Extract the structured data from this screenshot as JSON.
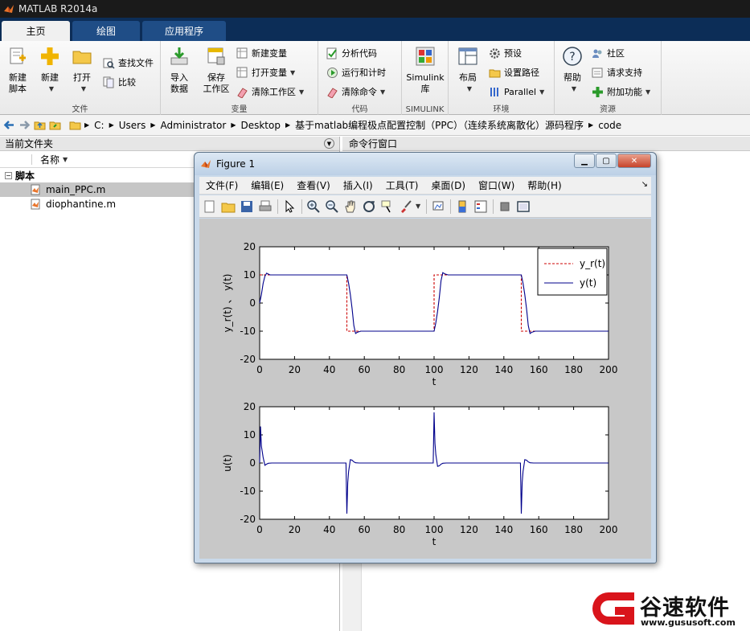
{
  "app": {
    "title": "MATLAB R2014a"
  },
  "ribbon": {
    "tabs": [
      "主页",
      "绘图",
      "应用程序"
    ],
    "file_group": {
      "label": "文件",
      "new_script": [
        "新建",
        "脚本"
      ],
      "new": "新建",
      "open": "打开",
      "find_files": "查找文件",
      "compare": "比较"
    },
    "variable_group": {
      "label": "变量",
      "import": [
        "导入",
        "数据"
      ],
      "save": [
        "保存",
        "工作区"
      ],
      "new_var": "新建变量",
      "open_var": "打开变量",
      "clear_ws": "清除工作区"
    },
    "code_group": {
      "label": "代码",
      "analyze": "分析代码",
      "run_time": "运行和计时",
      "clear_cmd": "清除命令"
    },
    "simulink_group": {
      "label": "SIMULINK",
      "lib": [
        "Simulink",
        "库"
      ]
    },
    "env_group": {
      "label": "环境",
      "layout": "布局",
      "prefs": "预设",
      "setpath": "设置路径",
      "parallel": "Parallel"
    },
    "resources_group": {
      "label": "资源",
      "help": "帮助",
      "community": "社区",
      "support": "请求支持",
      "addons": "附加功能"
    }
  },
  "address": {
    "segments": [
      "C:",
      "Users",
      "Administrator",
      "Desktop",
      "基于matlab编程极点配置控制（PPC）（连续系统离散化）源码程序",
      "code"
    ]
  },
  "current_folder": {
    "title": "当前文件夹",
    "column_name": "名称",
    "group": "脚本",
    "files": [
      "main_PPC.m",
      "diophantine.m"
    ]
  },
  "command_window": {
    "title": "命令行窗口"
  },
  "figure": {
    "title": "Figure 1",
    "menu": [
      "文件(F)",
      "编辑(E)",
      "查看(V)",
      "插入(I)",
      "工具(T)",
      "桌面(D)",
      "窗口(W)",
      "帮助(H)"
    ]
  },
  "chart_data": [
    {
      "type": "line",
      "xlabel": "t",
      "ylabel": "y_r(t) 、 y(t)",
      "xlim": [
        0,
        200
      ],
      "ylim": [
        -20,
        20
      ],
      "xticks": [
        0,
        20,
        40,
        60,
        80,
        100,
        120,
        140,
        160,
        180,
        200
      ],
      "yticks": [
        -20,
        -10,
        0,
        10,
        20
      ],
      "legend": {
        "placement": "top-right",
        "entries": [
          "y_r(t)",
          "y(t)"
        ]
      },
      "grid": false,
      "series": [
        {
          "name": "y_r(t)",
          "style": "dashed",
          "color": "#cc0000",
          "x": [
            0,
            50,
            50,
            100,
            100,
            150,
            150,
            200
          ],
          "y": [
            10,
            10,
            -10,
            -10,
            10,
            10,
            -10,
            -10
          ]
        },
        {
          "name": "y(t)",
          "style": "solid",
          "color": "#00008b",
          "x": [
            0,
            1,
            2,
            3,
            4,
            5,
            6,
            8,
            50,
            51,
            52,
            53,
            54,
            55,
            56,
            58,
            100,
            101,
            102,
            103,
            104,
            105,
            106,
            108,
            150,
            151,
            152,
            153,
            154,
            155,
            156,
            158,
            200
          ],
          "y": [
            0,
            3,
            7,
            9.5,
            10.6,
            10.3,
            10,
            10,
            10,
            7,
            3,
            -2,
            -8,
            -10.8,
            -10.4,
            -10,
            -10,
            -7,
            -3,
            2,
            8,
            10.8,
            10.4,
            10,
            10,
            7,
            3,
            -2,
            -8,
            -10.8,
            -10.4,
            -10,
            -10
          ]
        }
      ]
    },
    {
      "type": "line",
      "xlabel": "t",
      "ylabel": "u(t)",
      "xlim": [
        0,
        200
      ],
      "ylim": [
        -20,
        20
      ],
      "xticks": [
        0,
        20,
        40,
        60,
        80,
        100,
        120,
        140,
        160,
        180,
        200
      ],
      "yticks": [
        -20,
        -10,
        0,
        10,
        20
      ],
      "grid": false,
      "series": [
        {
          "name": "u(t)",
          "style": "solid",
          "color": "#00008b",
          "x": [
            0,
            0.5,
            1,
            2,
            3,
            4,
            5,
            7,
            49.5,
            50,
            50.5,
            51,
            52,
            53,
            54,
            55,
            57,
            99.5,
            100,
            100.5,
            101,
            102,
            103,
            104,
            105,
            107,
            149.5,
            150,
            150.5,
            151,
            152,
            153,
            154,
            155,
            157,
            200
          ],
          "y": [
            0,
            13,
            6,
            2,
            -0.8,
            -0.4,
            -0.1,
            0,
            0,
            -18,
            -7,
            -3,
            1.2,
            1,
            0.4,
            0.1,
            0,
            0,
            18,
            7,
            3,
            -1.2,
            -1,
            -0.4,
            -0.1,
            0,
            0,
            -18,
            -7,
            -3,
            1.2,
            1,
            0.4,
            0.1,
            0,
            0
          ]
        }
      ]
    }
  ],
  "watermark": {
    "name": "谷速软件",
    "url": "www.gususoft.com"
  }
}
